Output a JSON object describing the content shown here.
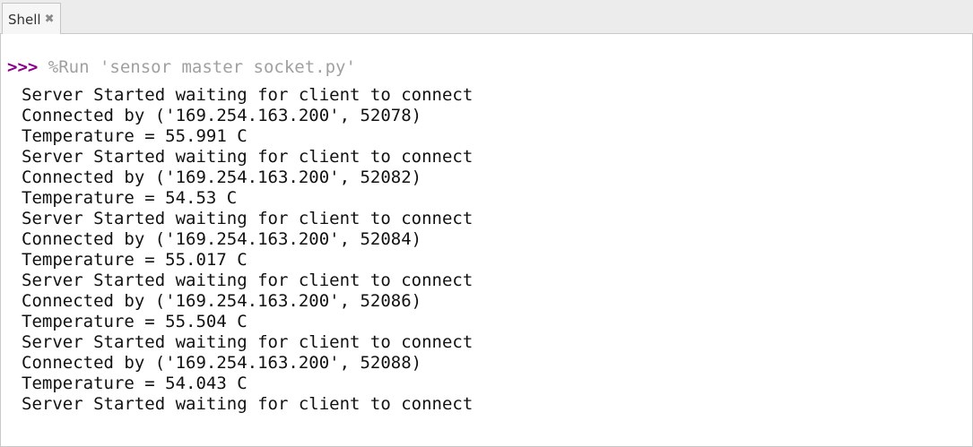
{
  "tab": {
    "label": "Shell",
    "close_glyph": "✖",
    "close_icon": "close-icon"
  },
  "shell": {
    "prompt": ">>> ",
    "command": "%Run 'sensor master socket.py'",
    "output": [
      "Server Started waiting for client to connect",
      "Connected by ('169.254.163.200', 52078)",
      "Temperature = 55.991 C",
      "Server Started waiting for client to connect",
      "Connected by ('169.254.163.200', 52082)",
      "Temperature = 54.53 C",
      "Server Started waiting for client to connect",
      "Connected by ('169.254.163.200', 52084)",
      "Temperature = 55.017 C",
      "Server Started waiting for client to connect",
      "Connected by ('169.254.163.200', 52086)",
      "Temperature = 55.504 C",
      "Server Started waiting for client to connect",
      "Connected by ('169.254.163.200', 52088)",
      "Temperature = 54.043 C",
      "Server Started waiting for client to connect"
    ]
  },
  "colors": {
    "prompt": "#8b008b",
    "command": "#a0a0a0",
    "output": "#111111"
  }
}
